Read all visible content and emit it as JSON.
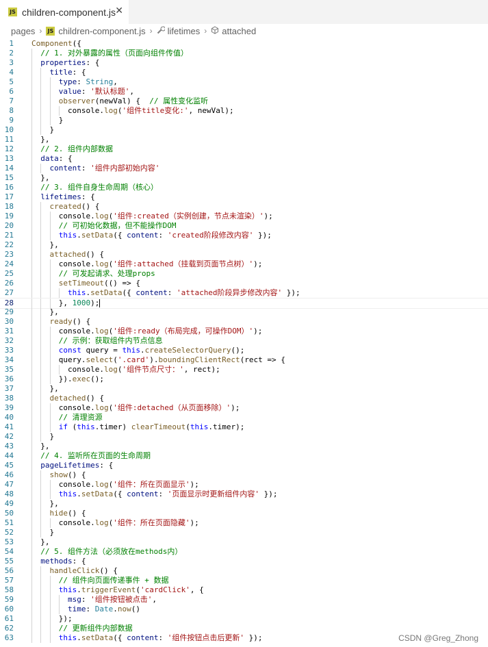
{
  "tab": {
    "icon": "JS",
    "filename": "children-component.js",
    "close": "✕"
  },
  "breadcrumb": {
    "folder": "pages",
    "file": "children-component.js",
    "prop": "lifetimes",
    "method": "attached"
  },
  "watermark": "CSDN @Greg_Zhong",
  "colors": {
    "keyword": "#0000ff",
    "property": "#001080",
    "function": "#795e26",
    "string": "#a31515",
    "number": "#098658",
    "comment": "#008000",
    "line_number": "#237893"
  },
  "code_lines": [
    "Component({",
    "  // 1. 对外暴露的属性（页面向组件传值）",
    "  properties: {",
    "    title: {",
    "      type: String,",
    "      value: '默认标题',",
    "      observer(newVal) {  // 属性变化监听",
    "        console.log('组件title变化:', newVal);",
    "      }",
    "    }",
    "  },",
    "  // 2. 组件内部数据",
    "  data: {",
    "    content: '组件内部初始内容'",
    "  },",
    "  // 3. 组件自身生命周期（核心）",
    "  lifetimes: {",
    "    created() {",
    "      console.log('组件:created（实例创建，节点未渲染）');",
    "      // 可初始化数据，但不能操作DOM",
    "      this.setData({ content: 'created阶段修改内容' });",
    "    },",
    "    attached() {",
    "      console.log('组件:attached（挂载到页面节点树）');",
    "      // 可发起请求、处理props",
    "      setTimeout(() => {",
    "        this.setData({ content: 'attached阶段异步修改内容' });",
    "      }, 1000);",
    "    },",
    "    ready() {",
    "      console.log('组件:ready（布局完成，可操作DOM）');",
    "      // 示例：获取组件内节点信息",
    "      const query = this.createSelectorQuery();",
    "      query.select('.card').boundingClientRect(rect => {",
    "        console.log('组件节点尺寸：', rect);",
    "      }).exec();",
    "    },",
    "    detached() {",
    "      console.log('组件:detached（从页面移除）');",
    "      // 清理资源",
    "      if (this.timer) clearTimeout(this.timer);",
    "    }",
    "  },",
    "  // 4. 监听所在页面的生命周期",
    "  pageLifetimes: {",
    "    show() {",
    "      console.log('组件：所在页面显示');",
    "      this.setData({ content: '页面显示时更新组件内容' });",
    "    },",
    "    hide() {",
    "      console.log('组件：所在页面隐藏');",
    "    }",
    "  },",
    "  // 5. 组件方法（必须放在methods内）",
    "  methods: {",
    "    handleClick() {",
    "      // 组件向页面传递事件 + 数据",
    "      this.triggerEvent('cardClick', {",
    "        msg: '组件按钮被点击',",
    "        time: Date.now()",
    "      });",
    "      // 更新组件内部数据",
    "      this.setData({ content: '组件按钮点击后更新' });"
  ],
  "active_line": 28
}
